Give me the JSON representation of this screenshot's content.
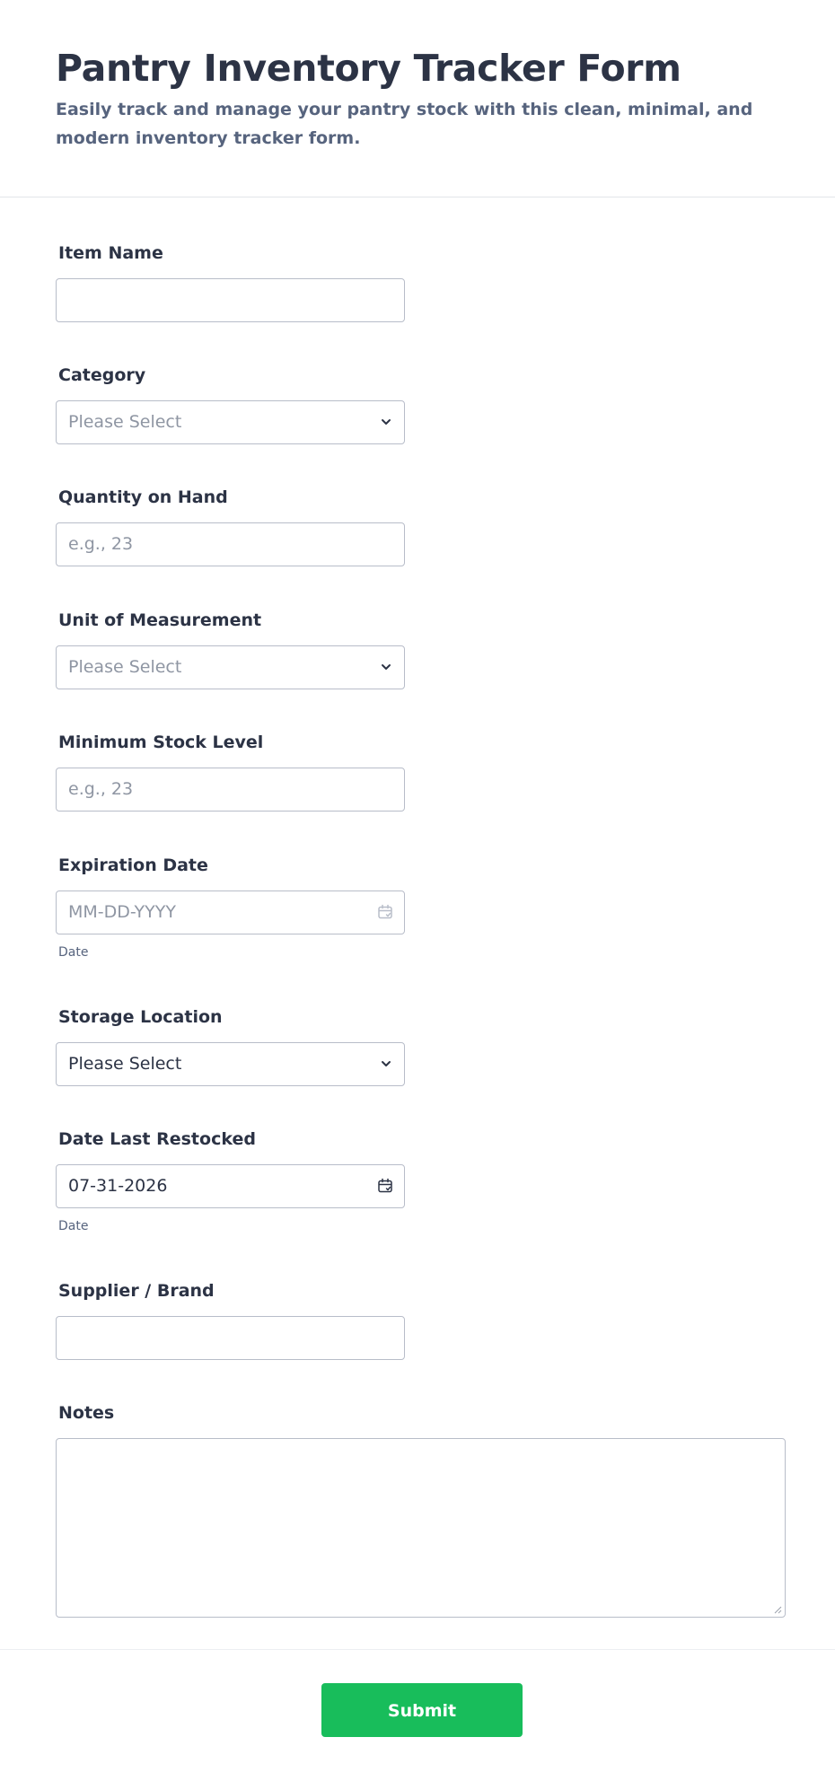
{
  "form": {
    "title": "Pantry Inventory Tracker Form",
    "subtitle": "Easily track and manage your pantry stock with this clean, minimal, and modern inventory tracker form."
  },
  "fields": {
    "item_name": {
      "label": "Item Name",
      "value": "",
      "placeholder": ""
    },
    "category": {
      "label": "Category",
      "value": "Please Select"
    },
    "quantity_on_hand": {
      "label": "Quantity on Hand",
      "placeholder": "e.g., 23"
    },
    "unit_of_measurement": {
      "label": "Unit of Measurement",
      "value": "Please Select"
    },
    "minimum_stock_level": {
      "label": "Minimum Stock Level",
      "placeholder": "e.g., 23"
    },
    "expiration_date": {
      "label": "Expiration Date",
      "placeholder": "MM-DD-YYYY",
      "sublabel": "Date"
    },
    "storage_location": {
      "label": "Storage Location",
      "value": "Please Select"
    },
    "date_last_restocked": {
      "label": "Date Last Restocked",
      "value": "07-31-2026",
      "sublabel": "Date"
    },
    "supplier_brand": {
      "label": "Supplier / Brand",
      "value": ""
    },
    "notes": {
      "label": "Notes",
      "value": ""
    }
  },
  "submit": {
    "label": "Submit"
  },
  "icons": {
    "dropdown": "chevron-down-icon",
    "date": "calendar-icon",
    "resize": "resize-grip-icon"
  },
  "colors": {
    "title": "#2c3345",
    "subtitle": "#57647e",
    "border": "#b8bdc9",
    "placeholder": "#8f96a3",
    "submit_bg": "#18bd5b",
    "submit_text": "#ffffff"
  }
}
